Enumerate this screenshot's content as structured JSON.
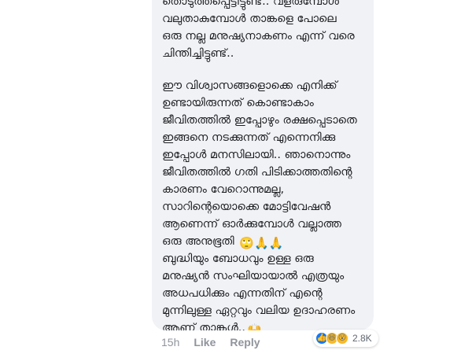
{
  "comment": {
    "paragraph_1": "തൊടുത്തപ്പെട്ടിട്ടുണ്ട്.. വളരുമ്പോൾ\nവലുതാകുമ്പോൾ താങ്കളെ പോലെ\nഒരു നല്ല മനുഷ്യനാകണം എന്ന് വരെ\nചിന്തിച്ചിട്ടുണ്ട്..",
    "paragraph_2": "ഈ വിശ്വാസങ്ങളൊക്കെ എനിക്ക്\nഉണ്ടായിരുന്നത് കൊണ്ടാകാം\nജീവിതത്തിൽ ഇപ്പോഴും രക്ഷപ്പെടാതെ\nഇങ്ങനെ നടക്കുന്നത് എന്നെനിക്കു\nഇപ്പോൾ മനസിലായി.. ഞാനൊന്നും\nജീവിതത്തിൽ ഗതി പിടിക്കാത്തതിന്റെ\nകാരണം വേറൊന്നുമല്ല,\nസാറിന്റെയൊക്കെ മോട്ടിവേഷൻ\nആണെന്ന് ഓർക്കുമ്പോൾ വല്ലാത്ത\nഒരു അനുഭൂതി",
    "paragraph_2_emojis": "🙄🙏🙏",
    "paragraph_3": "ബുദ്ധിയും ബോധവും ഉള്ള ഒരു\nമനുഷ്യൻ സംഘിയായാൽ എത്രയും\nഅധപധിക്കും എന്നതിന് എന്റെ\nമുന്നിലുള്ള ഏറ്റവും വലിയ ഉദാഹരണം\nആണ് താങ്കൾ..",
    "paragraph_3_emoji": "🙌"
  },
  "footer": {
    "time": "15h",
    "like_label": "Like",
    "reply_label": "Reply"
  },
  "reactions": {
    "icons": [
      "like-icon",
      "haha-icon",
      "wow-icon"
    ],
    "like_glyph": "👍",
    "haha_glyph": "😆",
    "wow_glyph": "😮",
    "count": "2.8K"
  },
  "colors": {
    "bubble": "#f0f2f5",
    "text": "#1c1e21",
    "meta": "#90949c",
    "like_blue": "#1877f2"
  }
}
